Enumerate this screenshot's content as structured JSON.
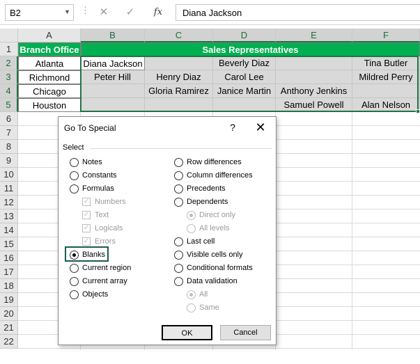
{
  "formula_bar": {
    "name_box": "B2",
    "fx_label": "fx",
    "cancel_glyph": "✕",
    "enter_glyph": "✓",
    "formula_value": "Diana Jackson"
  },
  "columns": [
    "A",
    "B",
    "C",
    "D",
    "E",
    "F"
  ],
  "rows": [
    "1",
    "2",
    "3",
    "4",
    "5",
    "6",
    "7",
    "8",
    "9",
    "10",
    "11",
    "12",
    "13",
    "14",
    "15",
    "16",
    "17",
    "18",
    "19",
    "20",
    "21",
    "22"
  ],
  "sheet": {
    "r1": {
      "a": "Branch Office",
      "merged": "Sales Representatives"
    },
    "r2": [
      "Atlanta",
      "Diana Jackson",
      "",
      "Beverly Diaz",
      "",
      "Tina Butler"
    ],
    "r3": [
      "Richmond",
      "Peter Hill",
      "Henry Diaz",
      "Carol Lee",
      "",
      "Mildred Perry"
    ],
    "r4": [
      "Chicago",
      "",
      "Gloria Ramirez",
      "Janice Martin",
      "Anthony Jenkins",
      ""
    ],
    "r5": [
      "Houston",
      "",
      "",
      "",
      "Samuel Powell",
      "Alan Nelson"
    ]
  },
  "dialog": {
    "title": "Go To Special",
    "help": "?",
    "close": "✕",
    "section_label": "Select",
    "left_options": {
      "notes": "Notes",
      "constants": "Constants",
      "formulas": "Formulas",
      "numbers": "Numbers",
      "text": "Text",
      "logicals": "Logicals",
      "errors": "Errors",
      "blanks": "Blanks",
      "current_region": "Current region",
      "current_array": "Current array",
      "objects": "Objects"
    },
    "right_options": {
      "row_differences": "Row differences",
      "column_differences": "Column differences",
      "precedents": "Precedents",
      "dependents": "Dependents",
      "direct_only": "Direct only",
      "all_levels": "All levels",
      "last_cell": "Last cell",
      "visible_cells_only": "Visible cells only",
      "conditional_formats": "Conditional formats",
      "data_validation": "Data validation",
      "all": "All",
      "same": "Same"
    },
    "selected_option": "Blanks",
    "ok_label": "OK",
    "cancel_label": "Cancel"
  },
  "colors": {
    "header_fill": "#00b050",
    "selection_fill": "#d9d9d9",
    "excel_green": "#217346"
  }
}
